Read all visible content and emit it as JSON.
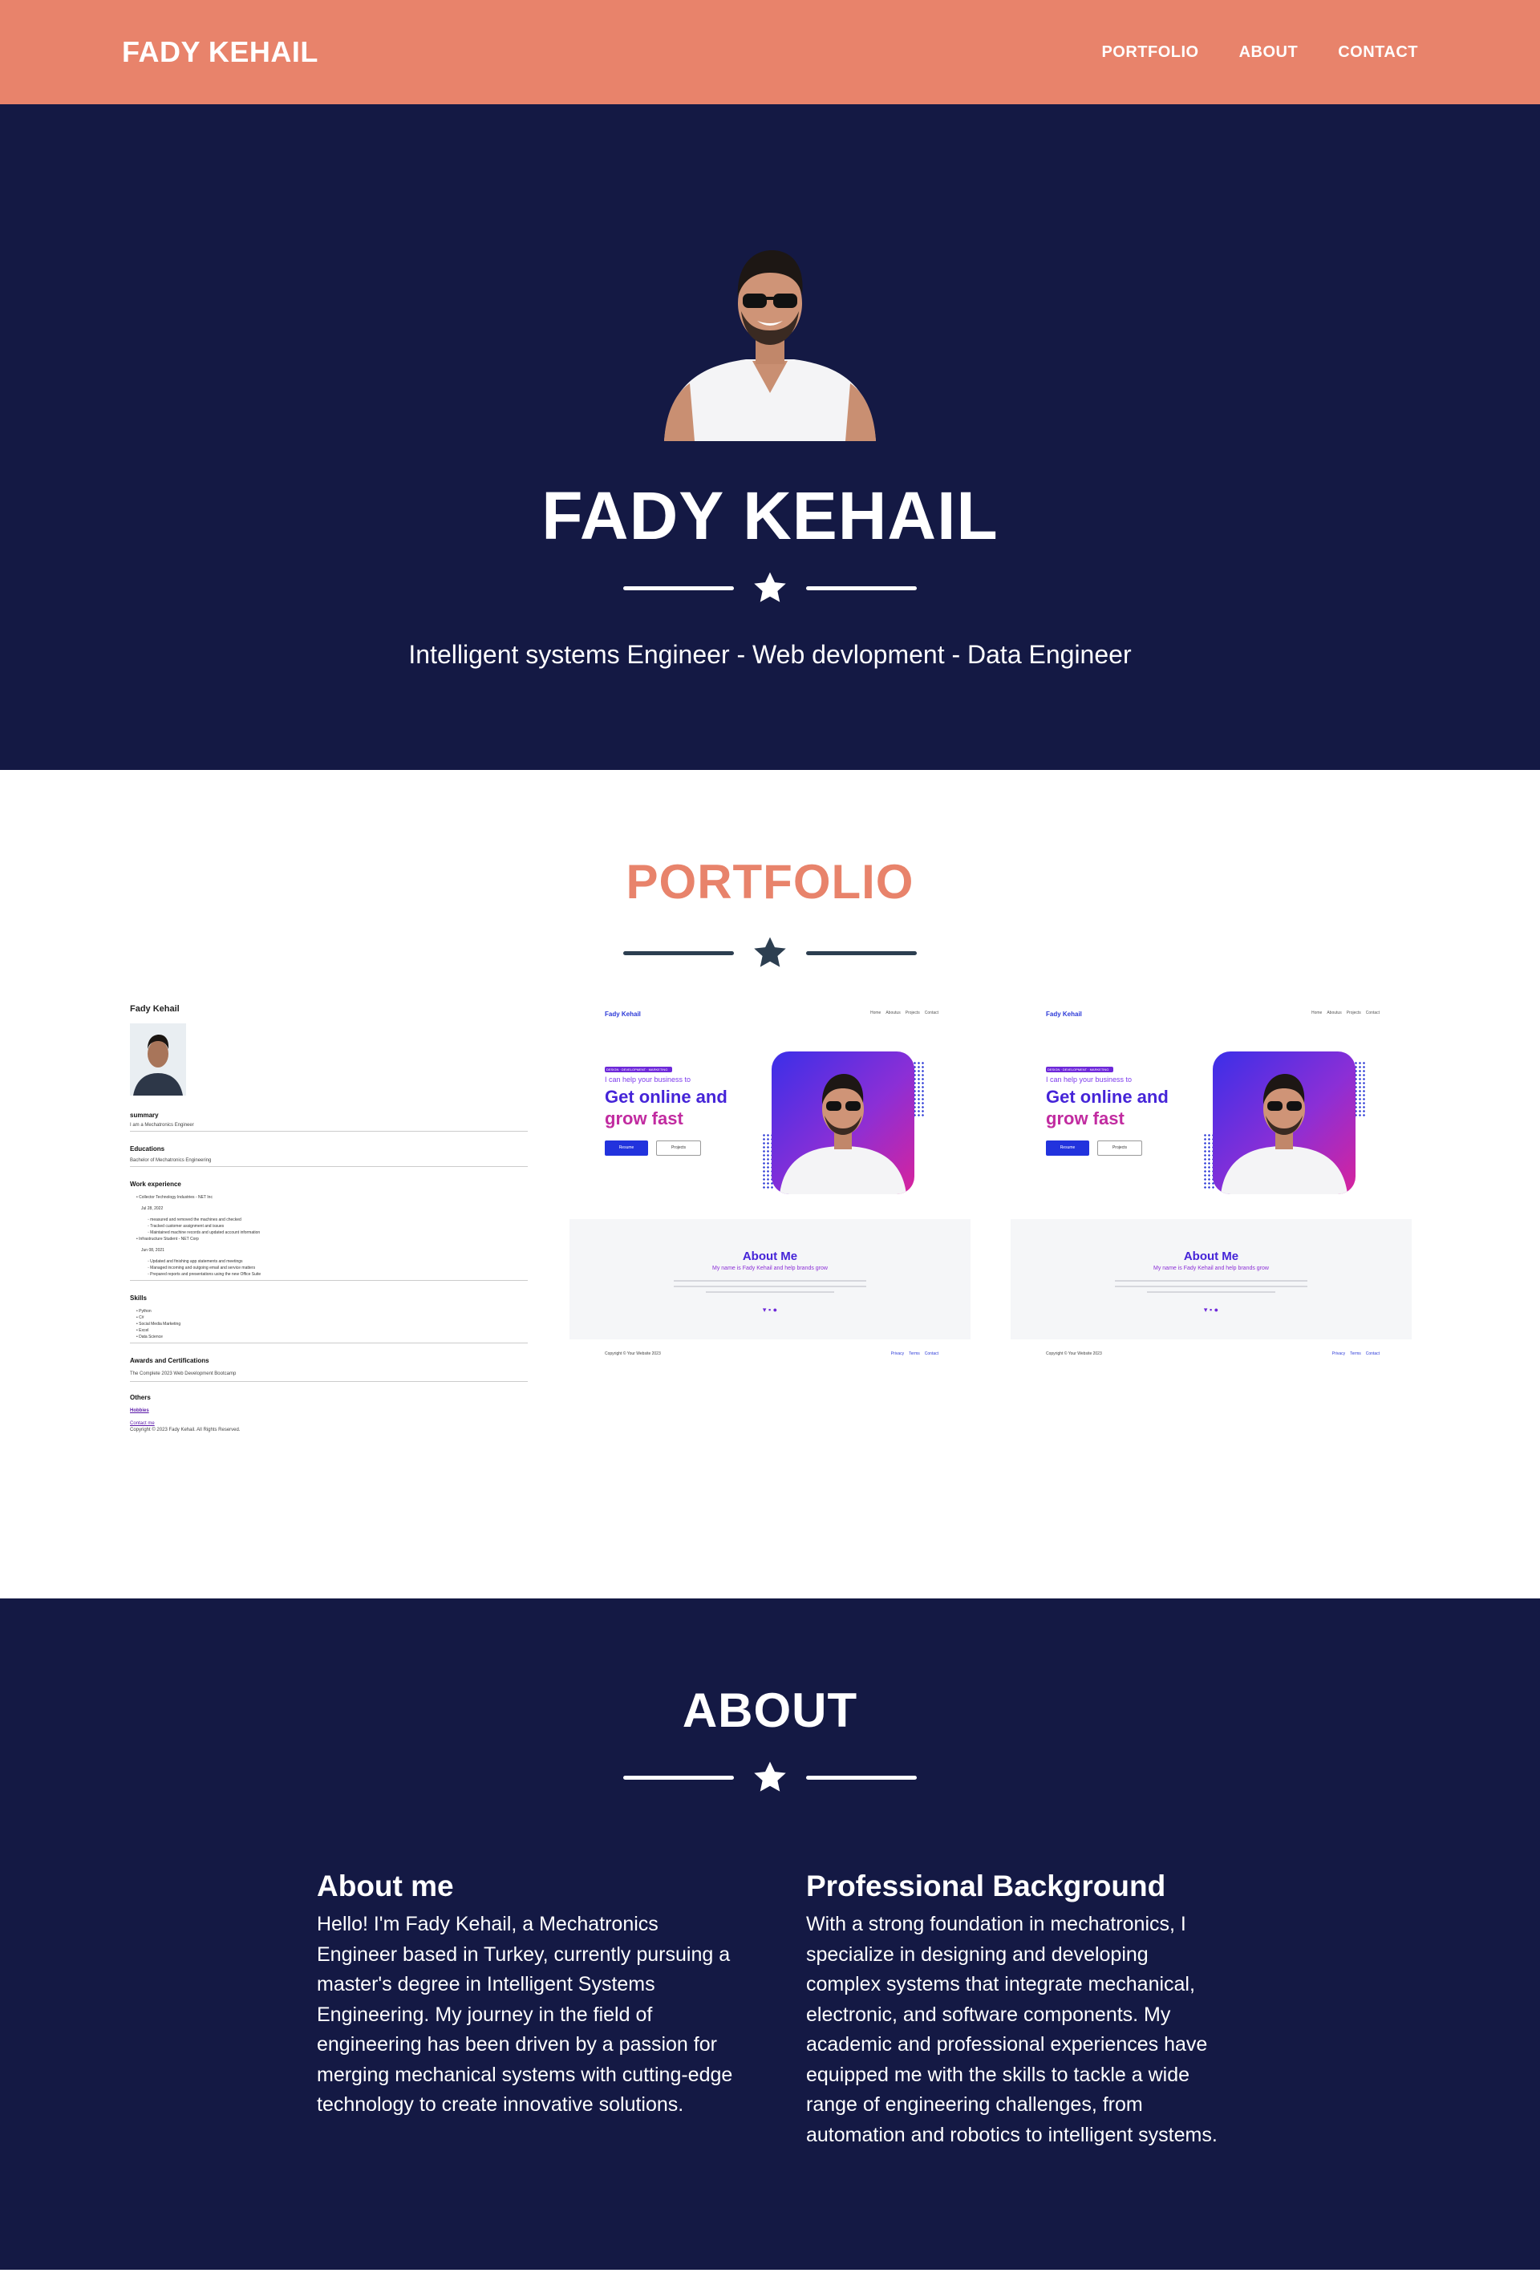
{
  "nav": {
    "brand": "FADY KEHAIL",
    "links": [
      "PORTFOLIO",
      "ABOUT",
      "CONTACT"
    ]
  },
  "hero": {
    "title": "FADY KEHAIL",
    "subtitle": "Intelligent systems Engineer - Web devlopment - Data Engineer"
  },
  "portfolio": {
    "title": "PORTFOLIO",
    "resume": {
      "name": "Fady Kehail",
      "sections": [
        "summary",
        "Educations",
        "Work experience",
        "Skills",
        "Awards and Certifications",
        "Others"
      ],
      "link": "Hobbies"
    },
    "site": {
      "brand": "Fady Kehail",
      "menu": [
        "Home",
        "Aboutus",
        "Projects",
        "Contact"
      ],
      "pre": "I can help your business to",
      "headline1": "Get online and",
      "headline2": "grow fast",
      "btn1": "Resume",
      "btn2": "Projects",
      "about_title": "About Me",
      "about_sub": "My name is Fady Kehail and help brands grow",
      "footer": "Copyright © Your Website 2023",
      "footer_links": [
        "Privacy",
        "Terms",
        "Contact"
      ]
    }
  },
  "about": {
    "title": "ABOUT",
    "left": {
      "heading": "About me",
      "text": "Hello! I'm Fady Kehail, a Mechatronics Engineer based in Turkey, currently pursuing a master's degree in Intelligent Systems Engineering. My journey in the field of engineering has been driven by a passion for merging mechanical systems with cutting-edge technology to create innovative solutions."
    },
    "right": {
      "heading": "Professional Background",
      "text": "With a strong foundation in mechatronics, I specialize in designing and developing complex systems that integrate mechanical, electronic, and software components. My academic and professional experiences have equipped me with the skills to tackle a wide range of engineering challenges, from automation and robotics to intelligent systems."
    }
  },
  "colors": {
    "accent": "#e8836b",
    "navy": "#141944",
    "divider_dark": "#2c3e50"
  }
}
